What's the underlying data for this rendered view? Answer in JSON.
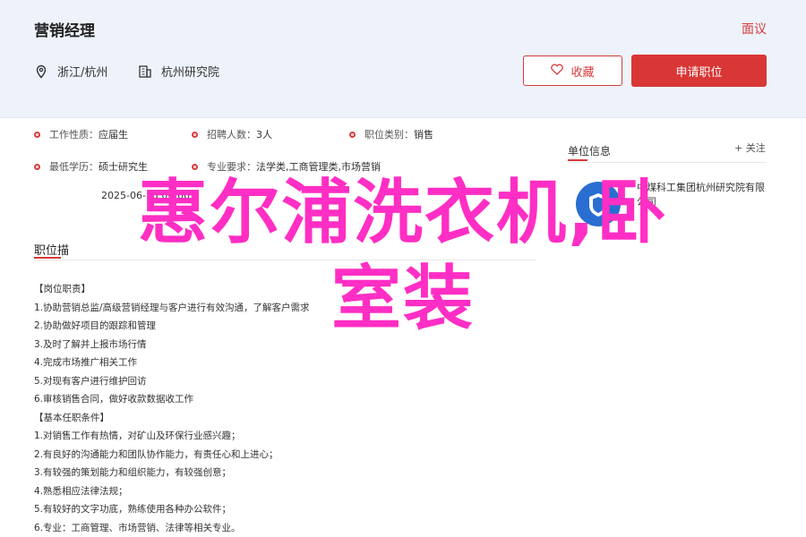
{
  "header": {
    "job_title": "营销经理",
    "report_label": "面议",
    "location": "浙江/杭州",
    "company": "杭州研究院",
    "fav_label": "收藏",
    "apply_label": "申请职位"
  },
  "info": {
    "nature_k": "工作性质：",
    "nature_v": "应届生",
    "recruit_k": "招聘人数：",
    "recruit_v": "3人",
    "category_k": "职位类别：",
    "category_v": "销售",
    "edu_k": "最低学历：",
    "edu_v": "硕士研究生",
    "major_k": "专业要求：",
    "major_v": "法学类,工商管理类,市场营销",
    "date_v": "2025-06-15 00:00"
  },
  "description": {
    "title": "职位描",
    "lines": [
      "【岗位职责】",
      "1.协助营销总监/高级营销经理与客户进行有效沟通，了解客户需求",
      "2.协助做好项目的跟踪和管理",
      "3.及时了解并上报市场行情",
      "4.完成市场推广相关工作",
      "5.对现有客户进行维护回访",
      "6.审核销售合同，做好收款数据收工作",
      "【基本任职条件】",
      "1.对销售工作有热情，对矿山及环保行业感兴趣；",
      "2.有良好的沟通能力和团队协作能力，有责任心和上进心；",
      "3.有较强的策划能力和组织能力，有较强创意；",
      "4.熟悉相应法律法规；",
      "5.有较好的文字功底，熟练使用各种办公软件；",
      "6.专业：工商管理、市场营销、法律等相关专业。"
    ]
  },
  "side": {
    "title": "单位信息",
    "follow": "+ 关注",
    "company_name": "中煤科工集团杭州研究院有限",
    "company_name2": "公司"
  },
  "overlay": {
    "line1": "惠尔浦洗衣机,卧",
    "line2": "室装"
  },
  "colors": {
    "accent": "#d63a3a",
    "overlay": "#ff2ec4",
    "header_bg": "#eef3fb"
  }
}
